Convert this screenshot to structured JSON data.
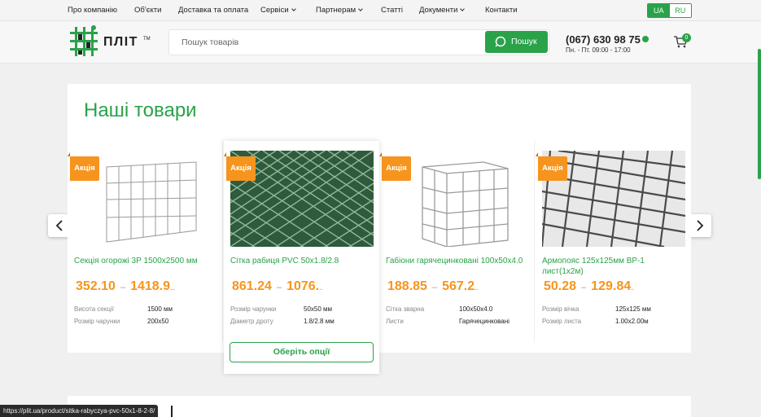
{
  "topnav": {
    "items": [
      {
        "label": "Про компанію",
        "dropdown": false
      },
      {
        "label": "Об'єкти",
        "dropdown": false
      },
      {
        "label": "Доставка та оплата",
        "dropdown": false
      },
      {
        "label": "Сервіси",
        "dropdown": true
      },
      {
        "label": "Партнерам",
        "dropdown": true
      },
      {
        "label": "Статті",
        "dropdown": false
      },
      {
        "label": "Документи",
        "dropdown": true
      },
      {
        "label": "Контакти",
        "dropdown": false
      }
    ],
    "languages": {
      "active": "UA",
      "inactive": "RU"
    }
  },
  "header": {
    "logo_text": "ПЛІТ",
    "logo_tm": "TM",
    "search_placeholder": "Пошук товарів",
    "search_button": "Пошук",
    "phone": "(067) 630 98 75",
    "hours": "Пн. - Пт. 09:00 - 17:00",
    "cart_count": "0"
  },
  "section": {
    "title": "Наші товари",
    "products": [
      {
        "badge": "Акція",
        "name": "Секція огорожі 3Р 1500х2500 мм",
        "price_min": "352.10",
        "price_max": "1418.9",
        "attrs": [
          {
            "label": "Висота секції",
            "value": "1500 мм"
          },
          {
            "label": "Розмір чарунки",
            "value": "200х50"
          }
        ]
      },
      {
        "badge": "Акція",
        "name": "Сітка рабиця PVC 50х1.8/2.8",
        "price_min": "861.24",
        "price_max": "1076.",
        "attrs": [
          {
            "label": "Розмір чарунки",
            "value": "50х50 мм"
          },
          {
            "label": "Діаметр дроту",
            "value": "1.8/2.8 мм"
          }
        ],
        "button": "Оберіть опції"
      },
      {
        "badge": "Акція",
        "name": "Габіони гарячецинковані 100х50х4.0",
        "price_min": "188.85",
        "price_max": "567.2",
        "attrs": [
          {
            "label": "Сітка зварна",
            "value": "100х50х4.0"
          },
          {
            "label": "Листи",
            "value": "Гарячецинковані"
          }
        ]
      },
      {
        "badge": "Акція",
        "name": "Армопояс 125х125мм ВР-1 лист(1х2м)",
        "price_min": "50.28",
        "price_max": "129.84",
        "attrs": [
          {
            "label": "Розмір вічка",
            "value": "125х125 мм"
          },
          {
            "label": "Розмір листа",
            "value": "1.00х2.00м"
          }
        ]
      }
    ]
  },
  "status_url": "https://plit.ua/product/sitka-rabyczya-pvc-50x1-8-2-8/",
  "colors": {
    "brand_green": "#2aa24a",
    "accent_orange": "#f7941d"
  }
}
